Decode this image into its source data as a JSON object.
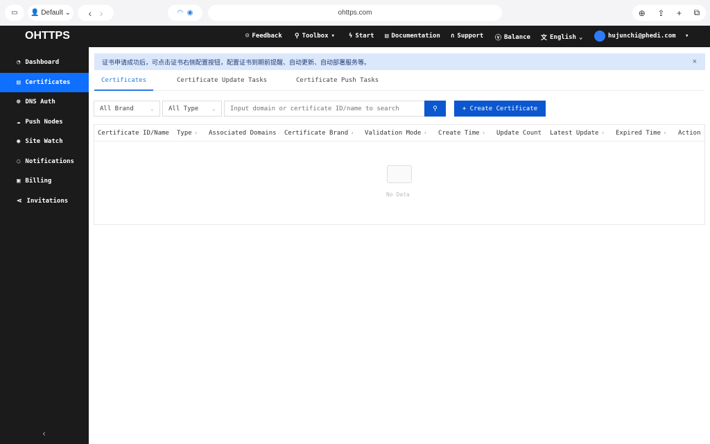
{
  "browser": {
    "profile": "Default",
    "url": "ohttps.com"
  },
  "header": {
    "logo": "OHTTPS",
    "nav": [
      {
        "label": "Feedback",
        "icon": "smile-icon"
      },
      {
        "label": "Toolbox",
        "icon": "wrench-icon"
      },
      {
        "label": "Start",
        "icon": "bolt-icon"
      },
      {
        "label": "Documentation",
        "icon": "doc-icon"
      },
      {
        "label": "Support",
        "icon": "headset-icon"
      },
      {
        "label": "Balance",
        "icon": "coin-icon"
      },
      {
        "label": "English",
        "icon": "translate-icon"
      }
    ],
    "user": "hujunchi@phedi.com"
  },
  "sidebar": {
    "items": [
      {
        "label": "Dashboard",
        "icon": "◔"
      },
      {
        "label": "Certificates",
        "icon": "▤"
      },
      {
        "label": "DNS Auth",
        "icon": "⊕"
      },
      {
        "label": "Push Nodes",
        "icon": "☁"
      },
      {
        "label": "Site Watch",
        "icon": "◉"
      },
      {
        "label": "Notifications",
        "icon": "◌"
      },
      {
        "label": "Billing",
        "icon": "▣"
      },
      {
        "label": "Invitations",
        "icon": "⋖"
      }
    ],
    "active": "Certificates"
  },
  "banner": {
    "text": "证书申请成功后，可点击证书右侧配置按钮，配置证书到期前提醒、自动更新、自动部署服务等。"
  },
  "tabs": [
    "Certificates",
    "Certificate Update Tasks",
    "Certificate Push Tasks"
  ],
  "filters": {
    "brand": "All Brand",
    "type": "All Type",
    "search_placeholder": "Input domain or certificate ID/name to search",
    "create_label": "+ Create Certificate"
  },
  "table": {
    "columns": [
      "Certificate ID/Name",
      "Type",
      "Associated Domains",
      "Certificate Brand",
      "Validation Mode",
      "Create Time",
      "Update Count",
      "Latest Update",
      "Expired Time",
      "Action"
    ],
    "empty": "No Data"
  },
  "colors": {
    "accent": "#0f6fff",
    "button": "#0b57d0",
    "dark": "#1b1b1b",
    "banner": "#dbe7fb"
  }
}
